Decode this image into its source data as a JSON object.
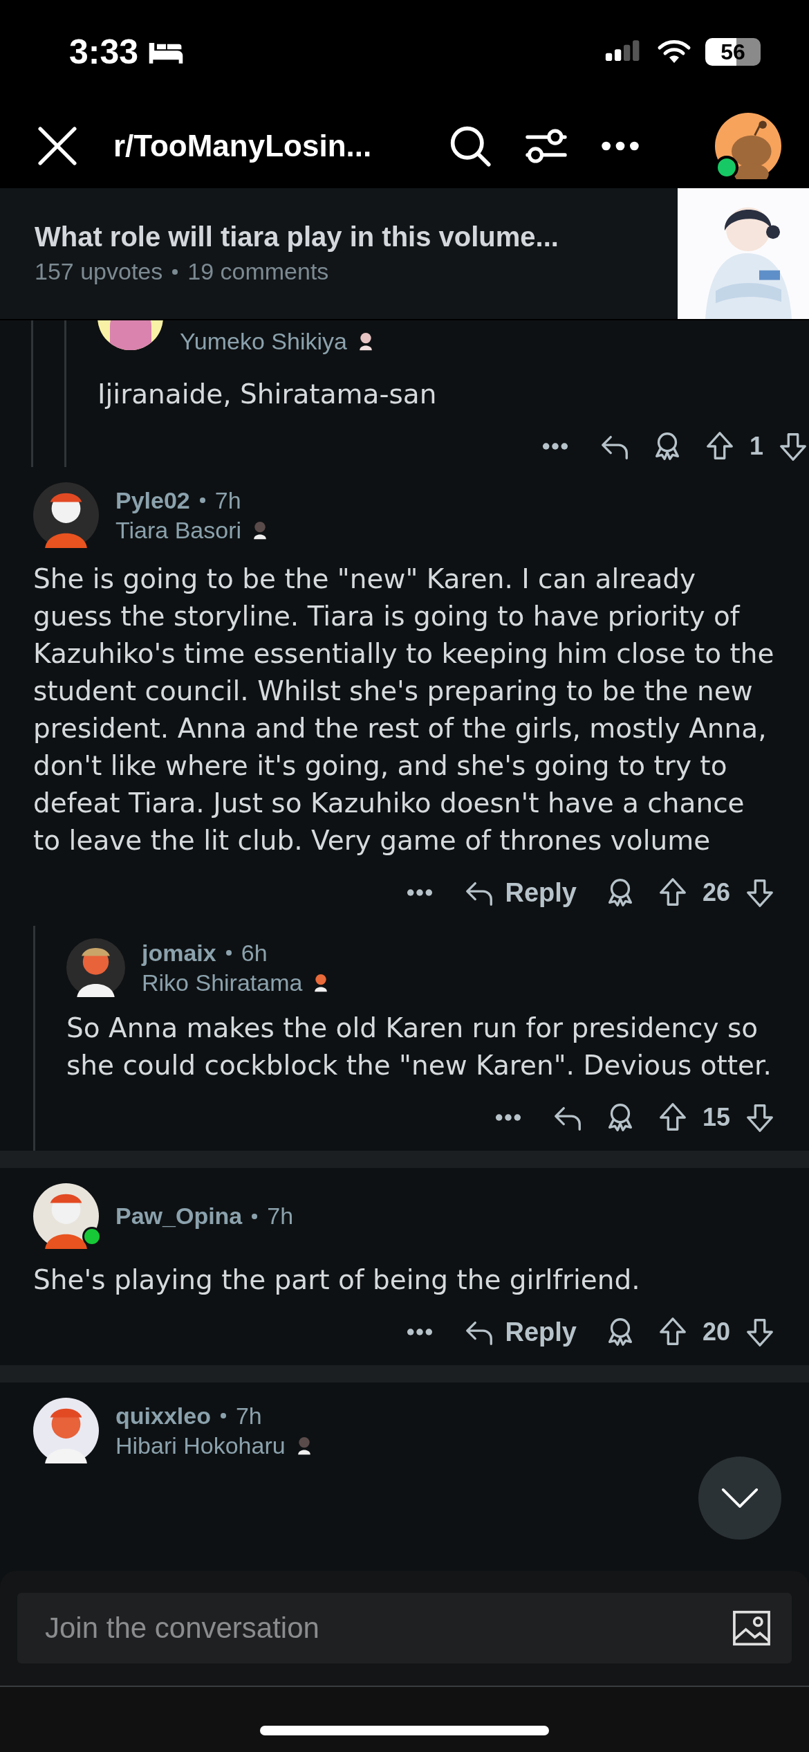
{
  "status_bar": {
    "time": "3:33",
    "battery": "56"
  },
  "header": {
    "title": "r/TooManyLosin...",
    "online": true
  },
  "post": {
    "title": "What role will tiara play in this volume...",
    "upvotes": "157 upvotes",
    "comments": "19 comments"
  },
  "partial_comment": {
    "flair": "Yumeko Shikiya",
    "body": "Ijiranaide, Shiratama-san",
    "score": "1"
  },
  "comments": [
    {
      "username": "Pyle02",
      "time": "7h",
      "flair": "Tiara Basori",
      "online": false,
      "body": "She is going to be the \"new\" Karen. I can already guess the storyline. Tiara is going to have priority of Kazuhiko's time essentially to keeping him close to the student council. Whilst she's preparing to be the new president. Anna and the rest of the girls, mostly Anna, don't like where it's going, and she's going to try to defeat Tiara. Just so Kazuhiko doesn't have a chance to leave the lit club. Very game of thrones volume",
      "reply_label": "Reply",
      "score": "26",
      "children": [
        {
          "username": "jomaix",
          "time": "6h",
          "flair": "Riko Shiratama",
          "online": false,
          "body": "So Anna makes the old Karen run for presidency so she could cockblock the \"new Karen\". Devious otter.",
          "score": "15"
        }
      ]
    },
    {
      "username": "Paw_Opina",
      "time": "7h",
      "online": true,
      "body": "She's playing the part of being the girlfriend.",
      "reply_label": "Reply",
      "score": "20"
    },
    {
      "username": "quixxleo",
      "time": "7h",
      "flair": "Hibari Hokoharu",
      "online": false
    }
  ],
  "composer": {
    "placeholder": "Join the conversation"
  }
}
